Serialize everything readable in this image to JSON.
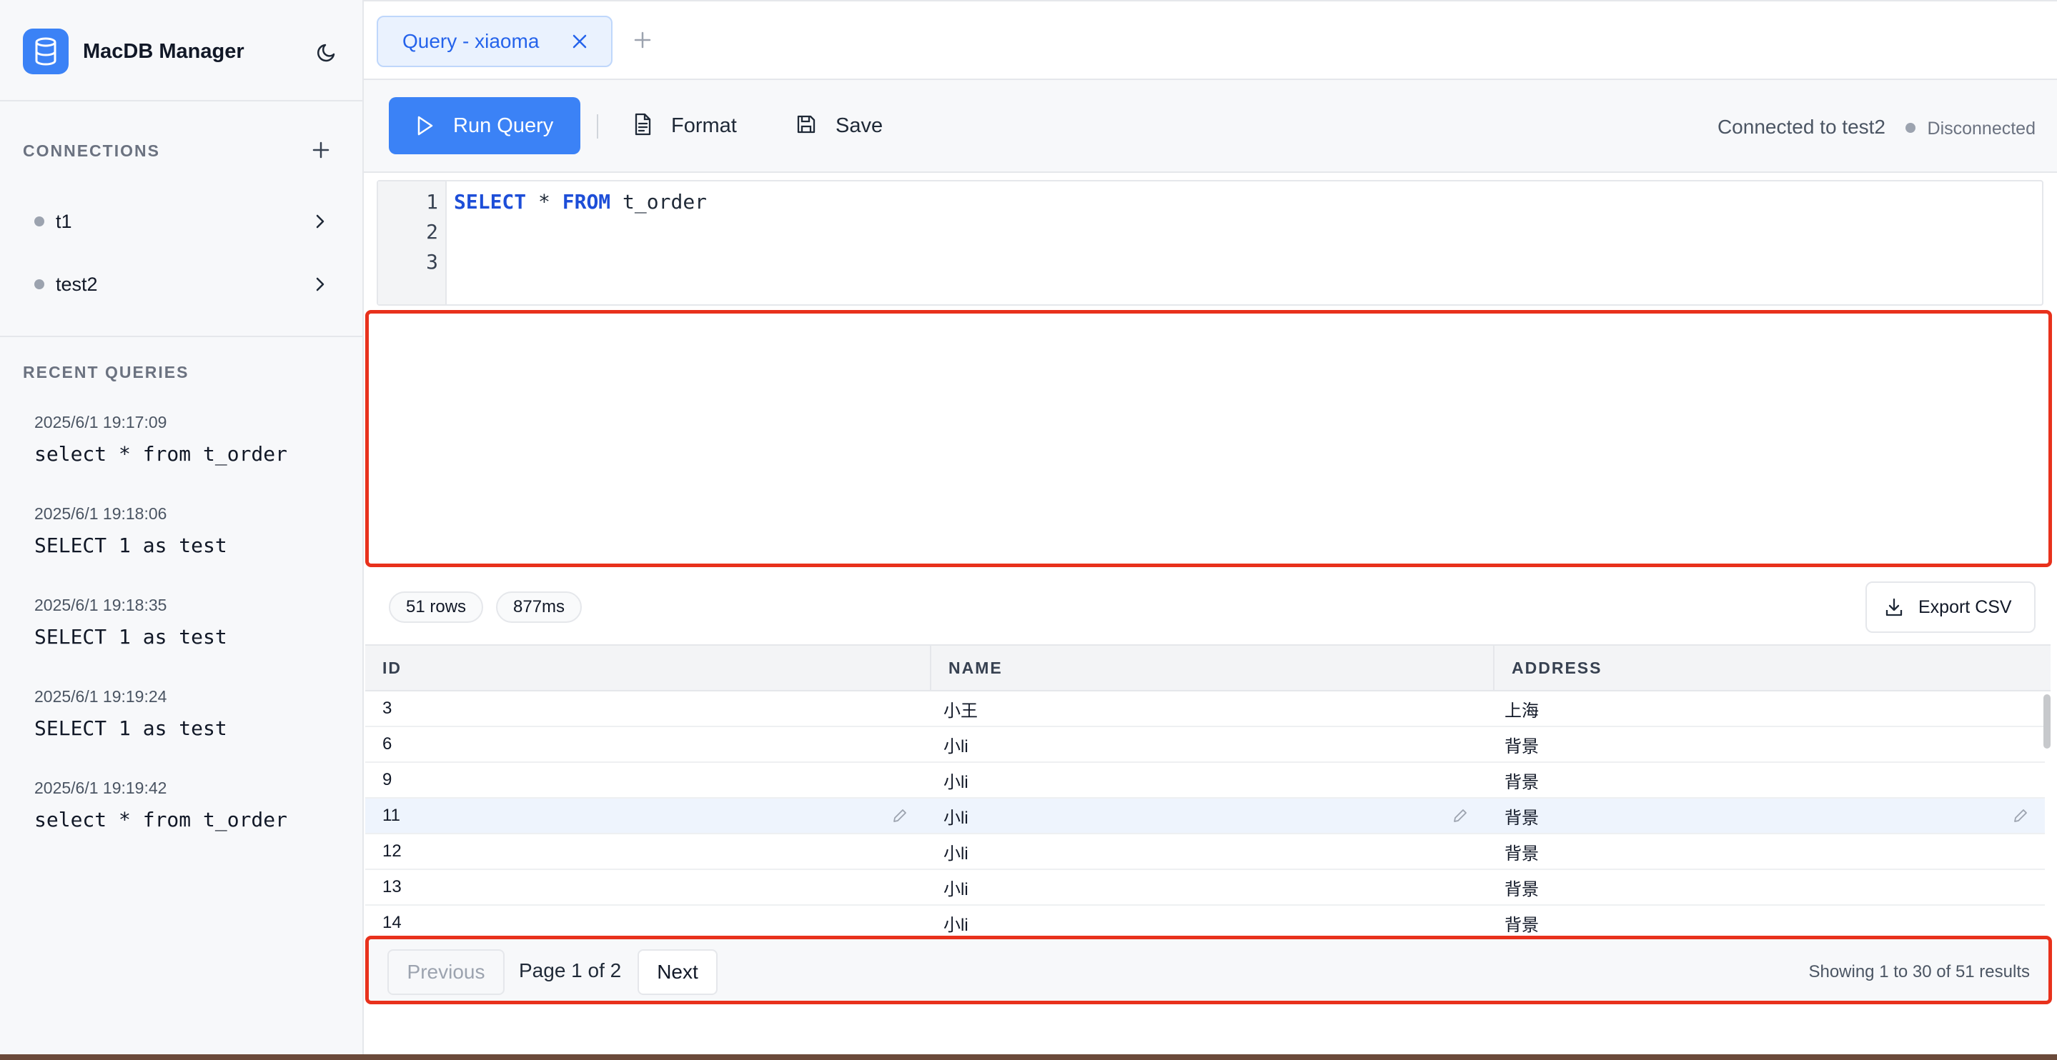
{
  "app": {
    "title": "MacDB Manager"
  },
  "sidebar": {
    "connections_title": "CONNECTIONS",
    "connections": [
      {
        "label": "t1"
      },
      {
        "label": "test2"
      }
    ],
    "recent_title": "RECENT QUERIES",
    "recent": [
      {
        "time": "2025/6/1 19:17:09",
        "sql": "select * from t_order"
      },
      {
        "time": "2025/6/1 19:18:06",
        "sql": "SELECT 1 as test"
      },
      {
        "time": "2025/6/1 19:18:35",
        "sql": "SELECT 1 as test"
      },
      {
        "time": "2025/6/1 19:19:24",
        "sql": "SELECT 1 as test"
      },
      {
        "time": "2025/6/1 19:19:42",
        "sql": "select * from t_order"
      }
    ]
  },
  "tabs": [
    {
      "label": "Query - xiaoma"
    }
  ],
  "toolbar": {
    "run_label": "Run Query",
    "format_label": "Format",
    "save_label": "Save",
    "connected_text": "Connected to test2",
    "status_text": "Disconnected"
  },
  "editor": {
    "line_numbers": [
      "1",
      "2",
      "3"
    ],
    "line1": {
      "kw1": "SELECT",
      "op": " * ",
      "kw2": "FROM",
      "rest": " t_order"
    }
  },
  "results": {
    "rows_pill": "51 rows",
    "time_pill": "877ms",
    "export_label": "Export CSV",
    "columns": [
      "ID",
      "NAME",
      "ADDRESS"
    ],
    "rows": [
      {
        "id": "3",
        "name": "小王",
        "address": "上海"
      },
      {
        "id": "6",
        "name": "小li",
        "address": "背景"
      },
      {
        "id": "9",
        "name": "小li",
        "address": "背景"
      },
      {
        "id": "11",
        "name": "小li",
        "address": "背景"
      },
      {
        "id": "12",
        "name": "小li",
        "address": "背景"
      },
      {
        "id": "13",
        "name": "小li",
        "address": "背景"
      },
      {
        "id": "14",
        "name": "小li",
        "address": "背景"
      }
    ]
  },
  "pagination": {
    "prev_label": "Previous",
    "page_info": "Page 1 of 2",
    "next_label": "Next",
    "summary": "Showing 1 to 30 of 51 results"
  },
  "colors": {
    "accent": "#3b82f6",
    "highlight_border": "#e8311c",
    "status_dot": "#9ca3af"
  },
  "icons": {
    "logo": "database-icon",
    "theme": "moon-icon",
    "add": "plus-icon",
    "chevron": "chevron-right-icon",
    "close": "close-icon",
    "run": "play-icon",
    "format": "document-icon",
    "save": "save-icon",
    "export": "download-icon",
    "edit": "pencil-icon"
  }
}
